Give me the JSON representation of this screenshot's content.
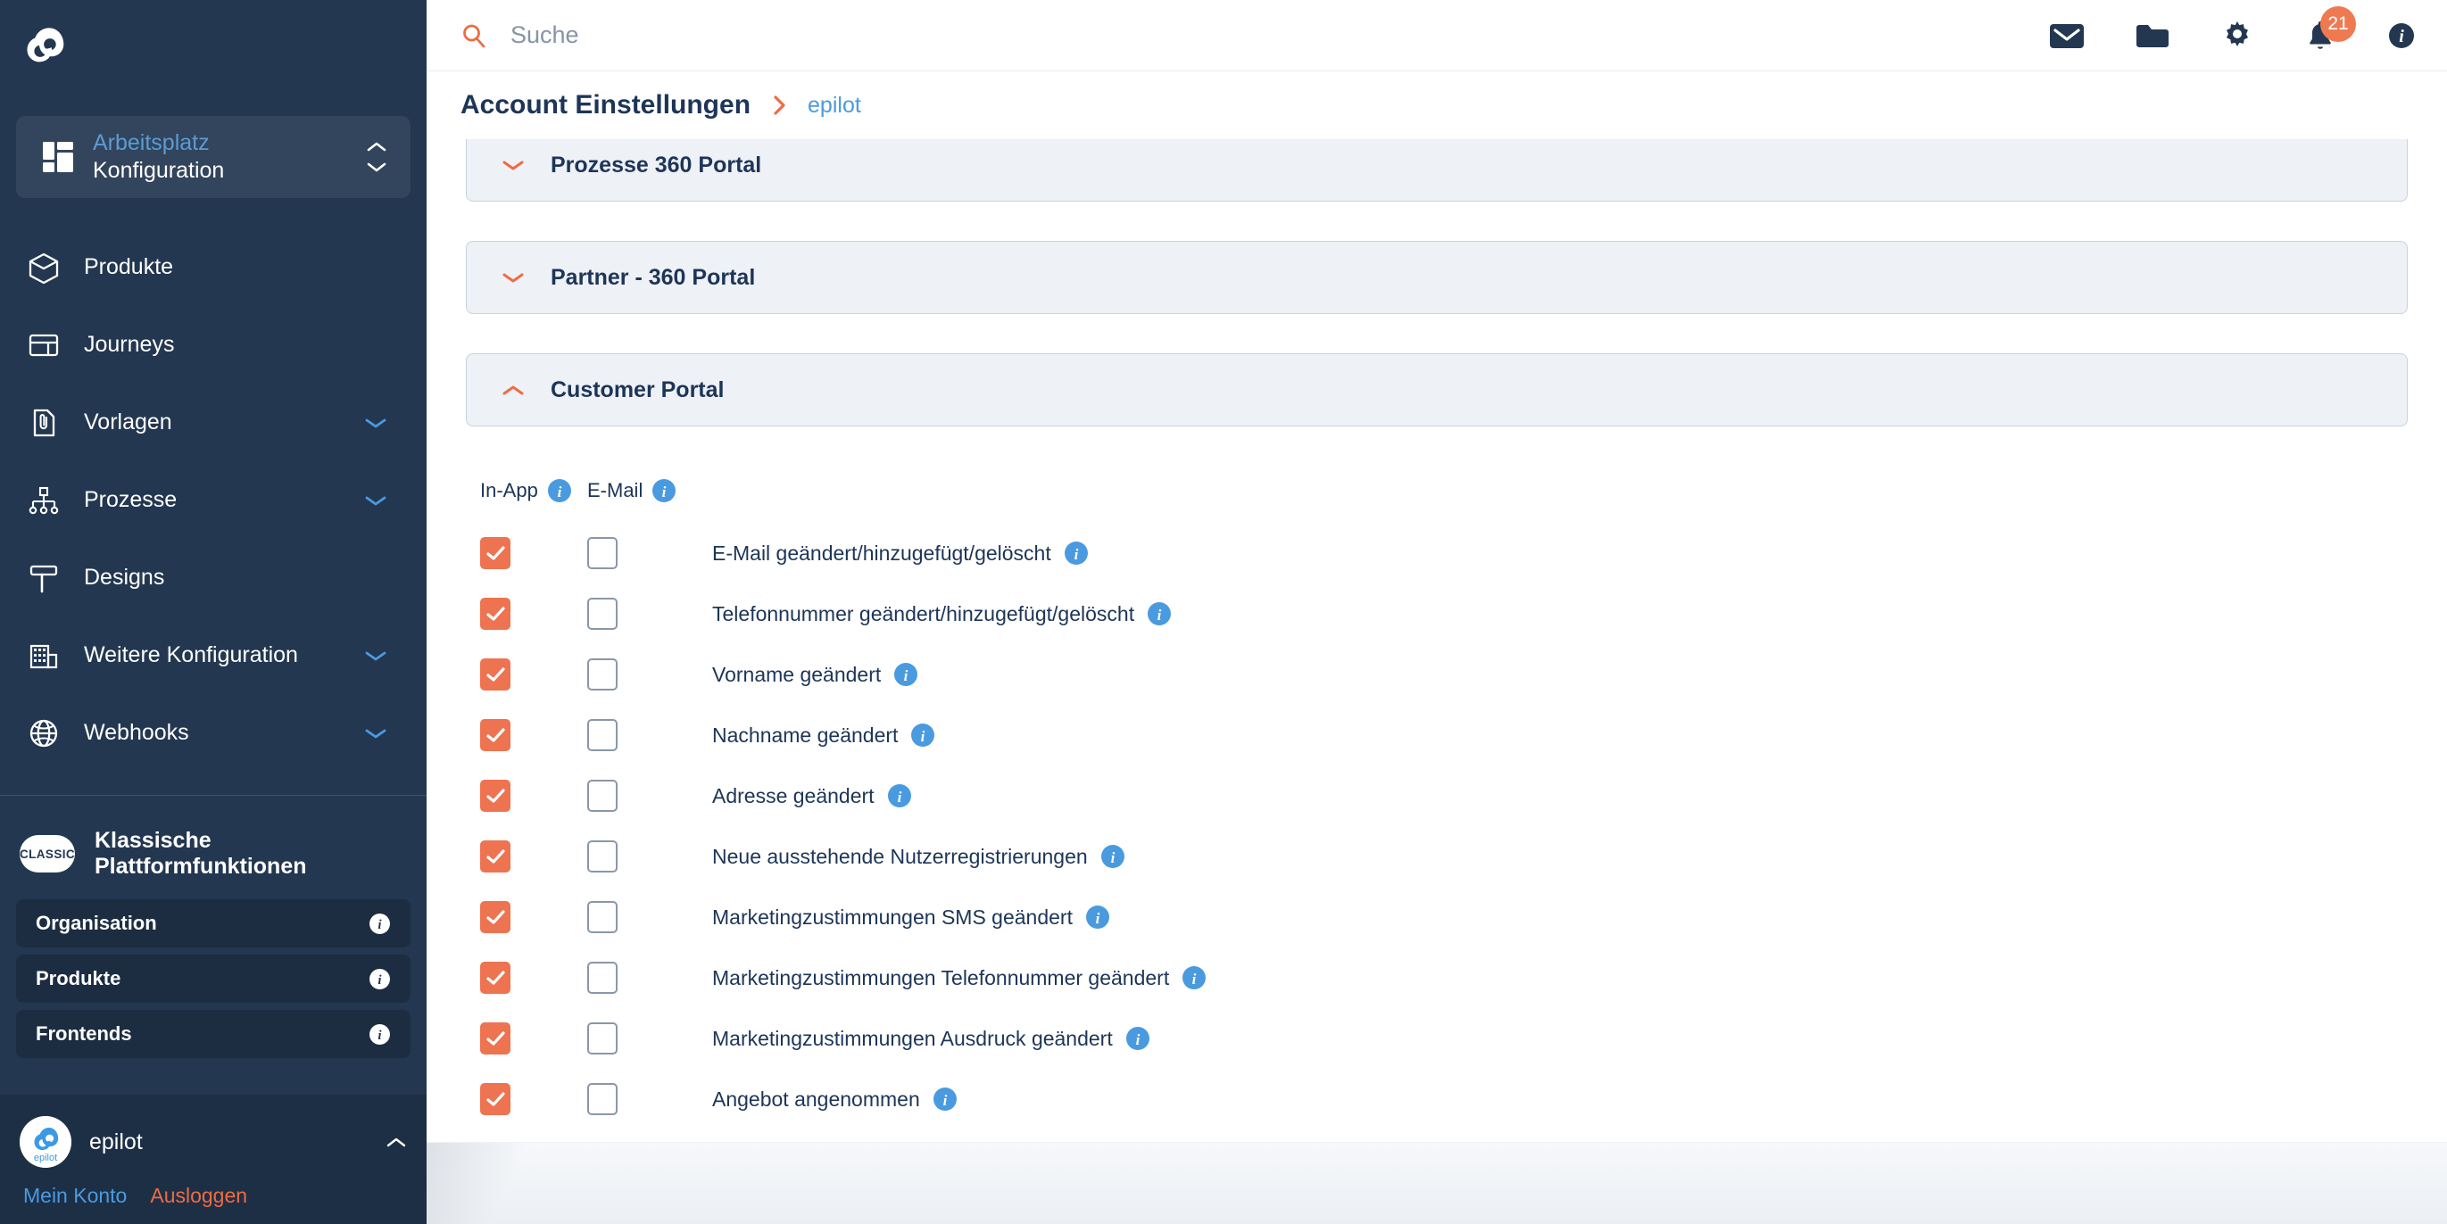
{
  "sidebar": {
    "logo_icon": "epilot-logo-icon",
    "workspace": {
      "icon": "grid-icon",
      "top_label": "Arbeitsplatz",
      "bottom_label": "Konfiguration",
      "chevron_up_icon": "chevron-up-icon",
      "chevron_down_icon": "chevron-down-icon"
    },
    "nav": [
      {
        "label": "Produkte",
        "icon": "box-icon",
        "has_caret": false
      },
      {
        "label": "Journeys",
        "icon": "layout-icon",
        "has_caret": false
      },
      {
        "label": "Vorlagen",
        "icon": "document-clip-icon",
        "has_caret": true
      },
      {
        "label": "Prozesse",
        "icon": "flow-icon",
        "has_caret": true
      },
      {
        "label": "Designs",
        "icon": "paint-roller-icon",
        "has_caret": false
      },
      {
        "label": "Weitere Konfiguration",
        "icon": "building-icon",
        "has_caret": true
      },
      {
        "label": "Webhooks",
        "icon": "globe-icon",
        "has_caret": true
      }
    ],
    "classic": {
      "pill_label": "CLASSIC",
      "title": "Klassische Plattformfunktionen",
      "items": [
        {
          "label": "Organisation",
          "info_icon": "info-icon"
        },
        {
          "label": "Produkte",
          "info_icon": "info-icon"
        },
        {
          "label": "Frontends",
          "info_icon": "info-icon"
        }
      ]
    },
    "user": {
      "avatar_icon": "epilot-avatar-icon",
      "name": "epilot",
      "collapse_icon": "chevron-up-icon",
      "account_link": "Mein Konto",
      "logout_link": "Ausloggen"
    }
  },
  "topbar": {
    "search_icon": "search-icon",
    "search_value": "",
    "search_placeholder": "Suche",
    "icons": [
      {
        "name": "mail-icon",
        "badge": ""
      },
      {
        "name": "folder-icon",
        "badge": ""
      },
      {
        "name": "gear-icon",
        "badge": ""
      },
      {
        "name": "bell-icon",
        "badge": "21"
      },
      {
        "name": "info-icon",
        "badge": ""
      }
    ]
  },
  "breadcrumb": {
    "title": "Account Einstellungen",
    "separator_icon": "chevron-right-icon",
    "link": "epilot"
  },
  "sections": [
    {
      "title": "Prozesse 360 Portal",
      "expanded": false,
      "caret_icon": "chevron-down-icon"
    },
    {
      "title": "Partner - 360 Portal",
      "expanded": false,
      "caret_icon": "chevron-down-icon"
    },
    {
      "title": "Customer Portal",
      "expanded": true,
      "caret_icon": "chevron-up-icon"
    }
  ],
  "notification_table": {
    "columns": [
      {
        "label": "In-App",
        "info_icon": "info-icon"
      },
      {
        "label": "E-Mail",
        "info_icon": "info-icon"
      }
    ],
    "rows": [
      {
        "in_app": true,
        "email": false,
        "label": "E-Mail geändert/hinzugefügt/gelöscht",
        "info_icon": "info-icon"
      },
      {
        "in_app": true,
        "email": false,
        "label": "Telefonnummer geändert/hinzugefügt/gelöscht",
        "info_icon": "info-icon"
      },
      {
        "in_app": true,
        "email": false,
        "label": "Vorname geändert",
        "info_icon": "info-icon"
      },
      {
        "in_app": true,
        "email": false,
        "label": "Nachname geändert",
        "info_icon": "info-icon"
      },
      {
        "in_app": true,
        "email": false,
        "label": "Adresse geändert",
        "info_icon": "info-icon"
      },
      {
        "in_app": true,
        "email": false,
        "label": "Neue ausstehende Nutzerregistrierungen",
        "info_icon": "info-icon"
      },
      {
        "in_app": true,
        "email": false,
        "label": "Marketingzustimmungen SMS geändert",
        "info_icon": "info-icon"
      },
      {
        "in_app": true,
        "email": false,
        "label": "Marketingzustimmungen Telefonnummer geändert",
        "info_icon": "info-icon"
      },
      {
        "in_app": true,
        "email": false,
        "label": "Marketingzustimmungen Ausdruck geändert",
        "info_icon": "info-icon"
      },
      {
        "in_app": true,
        "email": false,
        "label": "Angebot angenommen",
        "info_icon": "info-icon"
      }
    ]
  },
  "colors": {
    "sidebar_bg": "#233750",
    "accent_orange": "#ee7350",
    "link_blue": "#4a9ae0",
    "info_blue": "#4a9ae0",
    "panel_bg": "#eef1f6",
    "panel_border": "#c8d2e0",
    "text_dark": "#1d3557"
  }
}
